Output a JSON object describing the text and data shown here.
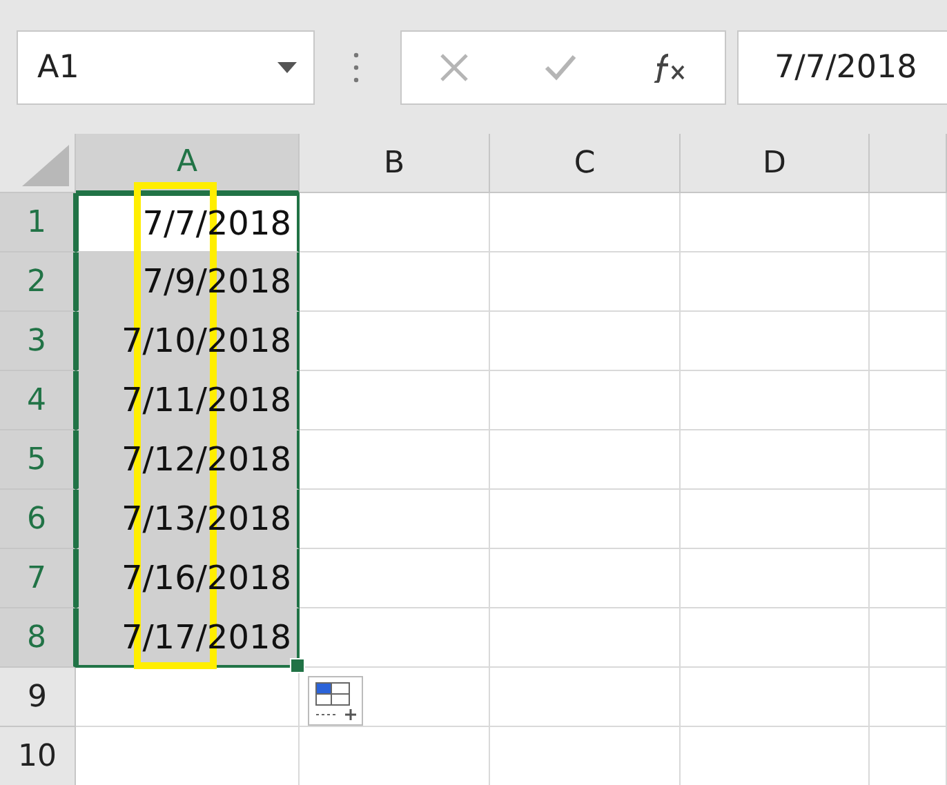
{
  "name_box": {
    "value": "A1"
  },
  "formula_bar": {
    "value": "7/7/2018"
  },
  "columns": [
    {
      "label": "A",
      "selected": true
    },
    {
      "label": "B",
      "selected": false
    },
    {
      "label": "C",
      "selected": false
    },
    {
      "label": "D",
      "selected": false
    }
  ],
  "rows": [
    {
      "header": "1",
      "selected": true,
      "cells": [
        {
          "value": "7/7/2018",
          "active": true
        }
      ]
    },
    {
      "header": "2",
      "selected": true,
      "cells": [
        {
          "value": "7/9/2018",
          "active": false
        }
      ]
    },
    {
      "header": "3",
      "selected": true,
      "cells": [
        {
          "value": "7/10/2018",
          "active": false
        }
      ]
    },
    {
      "header": "4",
      "selected": true,
      "cells": [
        {
          "value": "7/11/2018",
          "active": false
        }
      ]
    },
    {
      "header": "5",
      "selected": true,
      "cells": [
        {
          "value": "7/12/2018",
          "active": false
        }
      ]
    },
    {
      "header": "6",
      "selected": true,
      "cells": [
        {
          "value": "7/13/2018",
          "active": false
        }
      ]
    },
    {
      "header": "7",
      "selected": true,
      "cells": [
        {
          "value": "7/16/2018",
          "active": false
        }
      ]
    },
    {
      "header": "8",
      "selected": true,
      "cells": [
        {
          "value": "7/17/2018",
          "active": false
        }
      ]
    },
    {
      "header": "9",
      "selected": false,
      "cells": []
    },
    {
      "header": "10",
      "selected": false,
      "cells": []
    }
  ]
}
